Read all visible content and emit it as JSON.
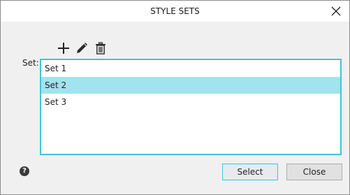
{
  "dialog": {
    "title": "STYLE SETS"
  },
  "toolbar": {
    "add_icon": "plus-icon",
    "edit_icon": "pencil-icon",
    "delete_icon": "trash-icon"
  },
  "form": {
    "set_label": "Set:",
    "items": [
      {
        "label": "Set 1",
        "selected": false
      },
      {
        "label": "Set 2",
        "selected": true
      },
      {
        "label": "Set 3",
        "selected": false
      }
    ]
  },
  "footer": {
    "help_icon": "help-icon",
    "help_glyph": "?",
    "select_label": "Select",
    "close_label": "Close"
  },
  "colors": {
    "accent": "#3cc6d6",
    "selection": "#a1e3ee",
    "background": "#f0f0f0"
  }
}
